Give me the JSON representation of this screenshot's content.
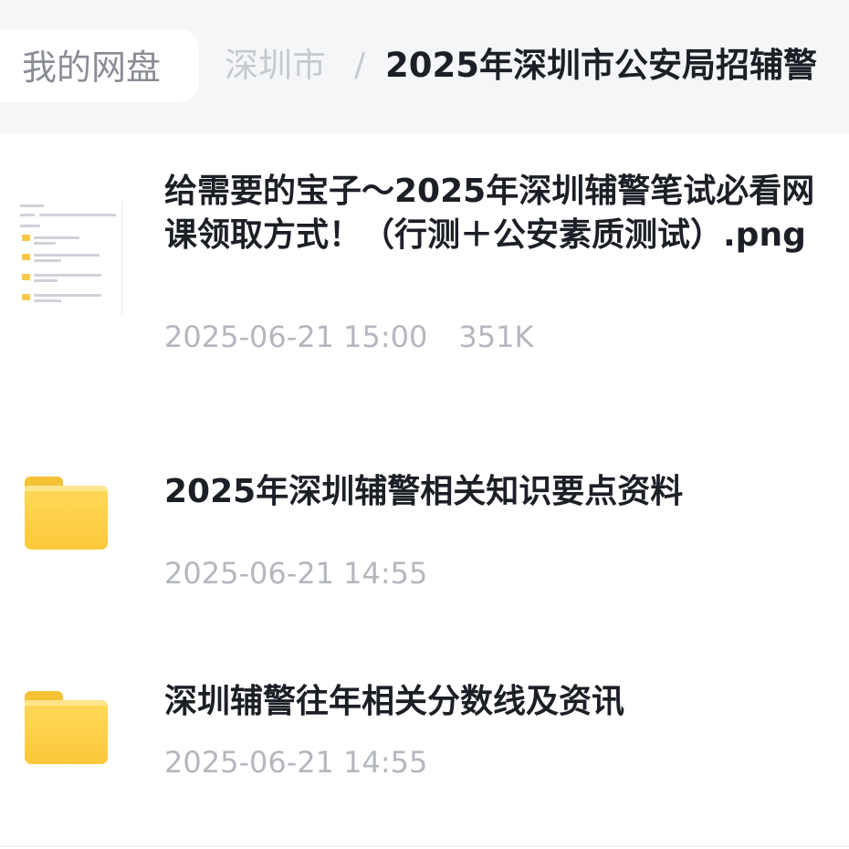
{
  "breadcrumb": {
    "root": "我的网盘",
    "city": "深圳市",
    "separator": "/",
    "current": "2025年深圳市公安局招辅警"
  },
  "files": [
    {
      "icon": "image-thumbnail",
      "name": "给需要的宝子～2025年深圳辅警笔试必看网课领取方式！（行测＋公安素质测试）.png",
      "date": "2025-06-21 15:00",
      "size": "351K"
    },
    {
      "icon": "folder-icon",
      "name": "2025年深圳辅警相关知识要点资料",
      "date": "2025-06-21 14:55"
    },
    {
      "icon": "folder-icon",
      "name": "深圳辅警往年相关分数线及资讯",
      "date": "2025-06-21 14:55"
    }
  ],
  "colors": {
    "header_bg": "#f5f6f8",
    "folder_yellow": "#fcc83a",
    "title_text": "#1c1f26",
    "meta_text": "#b4b7be"
  }
}
